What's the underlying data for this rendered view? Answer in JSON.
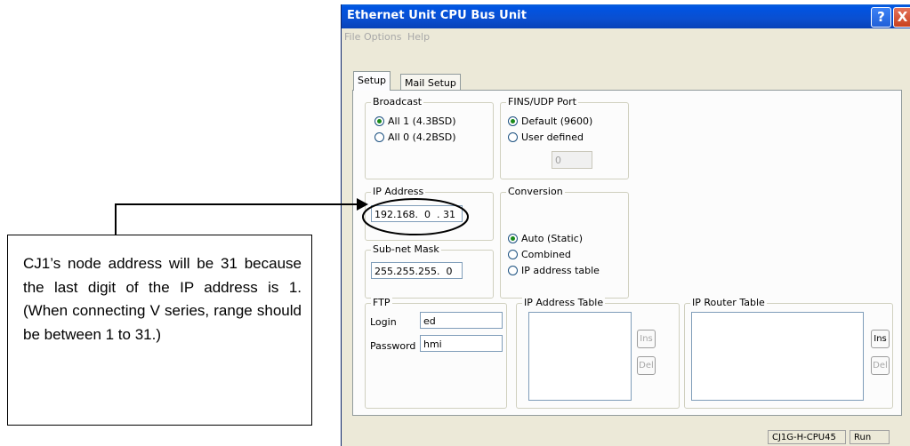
{
  "window": {
    "title": "Ethernet Unit CPU Bus Unit",
    "help_button": "?",
    "close_button": "X"
  },
  "menu": [
    "File",
    "Options",
    "Help"
  ],
  "tabs": [
    {
      "label": "Setup",
      "active": true
    },
    {
      "label": "Mail Setup",
      "active": false
    }
  ],
  "broadcast": {
    "legend": "Broadcast",
    "options": [
      {
        "label": "All 1 (4.3BSD)",
        "selected": true
      },
      {
        "label": "All 0 (4.2BSD)",
        "selected": false
      }
    ]
  },
  "fins_udp_port": {
    "legend": "FINS/UDP Port",
    "options": [
      {
        "label": "Default (9600)",
        "selected": true
      },
      {
        "label": "User defined",
        "selected": false
      }
    ],
    "user_value": "0"
  },
  "ip_address": {
    "legend": "IP Address",
    "value": "192.168.  0  . 31"
  },
  "conversion": {
    "legend": "Conversion",
    "options": [
      {
        "label": "Auto (Static)",
        "selected": true
      },
      {
        "label": "Combined",
        "selected": false
      },
      {
        "label": "IP address table",
        "selected": false
      }
    ]
  },
  "subnet_mask": {
    "legend": "Sub-net Mask",
    "value": "255.255.255.  0"
  },
  "ftp": {
    "legend": "FTP",
    "login_label": "Login",
    "login_value": "ed",
    "password_label": "Password",
    "password_value": "hmi"
  },
  "ip_address_table": {
    "legend": "IP Address Table",
    "ins_label": "Ins",
    "del_label": "Del"
  },
  "ip_router_table": {
    "legend": "IP Router Table",
    "ins_label": "Ins",
    "del_label": "Del"
  },
  "status": {
    "model": "CJ1G-H-CPU45",
    "mode": "Run"
  },
  "annotation": {
    "text": "CJ1’s node address will be 31 because the last digit of the IP address is 1. (When connecting V series, range should be between 1 to 31.)"
  },
  "colors": {
    "titlebar": "#0054e3",
    "dialog_bg": "#ece9d8",
    "radio_selected": "#1a8a1a"
  }
}
